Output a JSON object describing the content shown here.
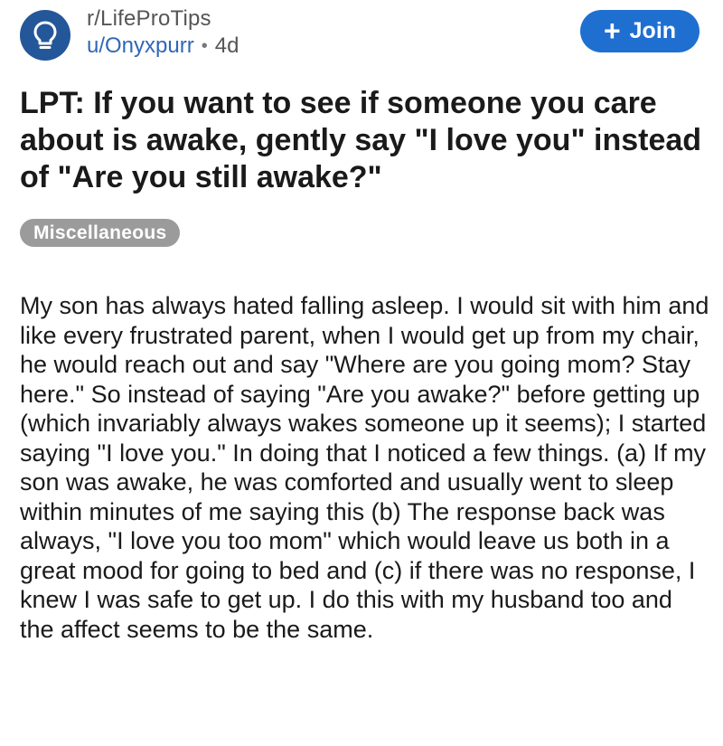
{
  "header": {
    "subreddit": "r/LifeProTips",
    "username": "u/Onyxpurr",
    "separator": "•",
    "age": "4d",
    "avatar_icon": "lightbulb-icon",
    "join_label": "Join",
    "join_icon": "plus-icon"
  },
  "post": {
    "title": "LPT: If you want to see if someone you care about is awake, gently say \"I love you\" instead of \"Are you still awake?\"",
    "flair": "Miscellaneous",
    "body": "My son has always hated falling asleep. I would sit with him and like every frustrated parent, when I would get up from my chair, he would reach out and say \"Where are you going mom? Stay here.\" So instead of saying \"Are you awake?\" before getting up (which invariably always wakes someone up it seems); I started saying \"I love you.\" In doing that I noticed a few things. (a) If my son was awake, he was comforted and usually went to sleep within minutes of me saying this (b) The response back was always, \"I love you too mom\" which would leave us both in a great mood for going to bed and (c) if there was no response, I knew I was safe to get up. I do this with my husband too and the affect seems to be the same."
  },
  "colors": {
    "avatar_bg": "#24579a",
    "join_bg": "#1f6fd1",
    "username": "#2f67b6",
    "flair_bg": "#9b9b9b",
    "text": "#1a1a1b"
  }
}
